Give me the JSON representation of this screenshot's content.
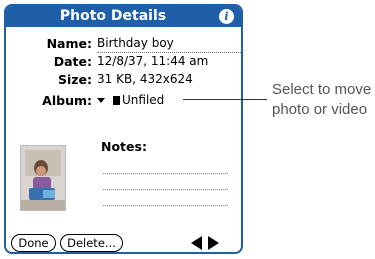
{
  "header": {
    "title": "Photo Details",
    "info_icon": "info-icon"
  },
  "fields": {
    "name_label": "Name:",
    "name_value": "Birthday boy",
    "date_label": "Date:",
    "date_value": "12/8/37, 11:44 am",
    "size_label": "Size:",
    "size_value": "31 KB, 432x624",
    "album_label": "Album:",
    "album_value": "Unfiled",
    "album_icon": "dropdown-arrow-icon"
  },
  "notes": {
    "label": "Notes:"
  },
  "buttons": {
    "done": "Done",
    "delete": "Delete...",
    "nav_icon": "left-right-arrows-icon"
  },
  "callout": {
    "text": "Select to move photo or video"
  },
  "colors": {
    "titlebar": "#1f5fa8",
    "callout_text": "#555555"
  }
}
